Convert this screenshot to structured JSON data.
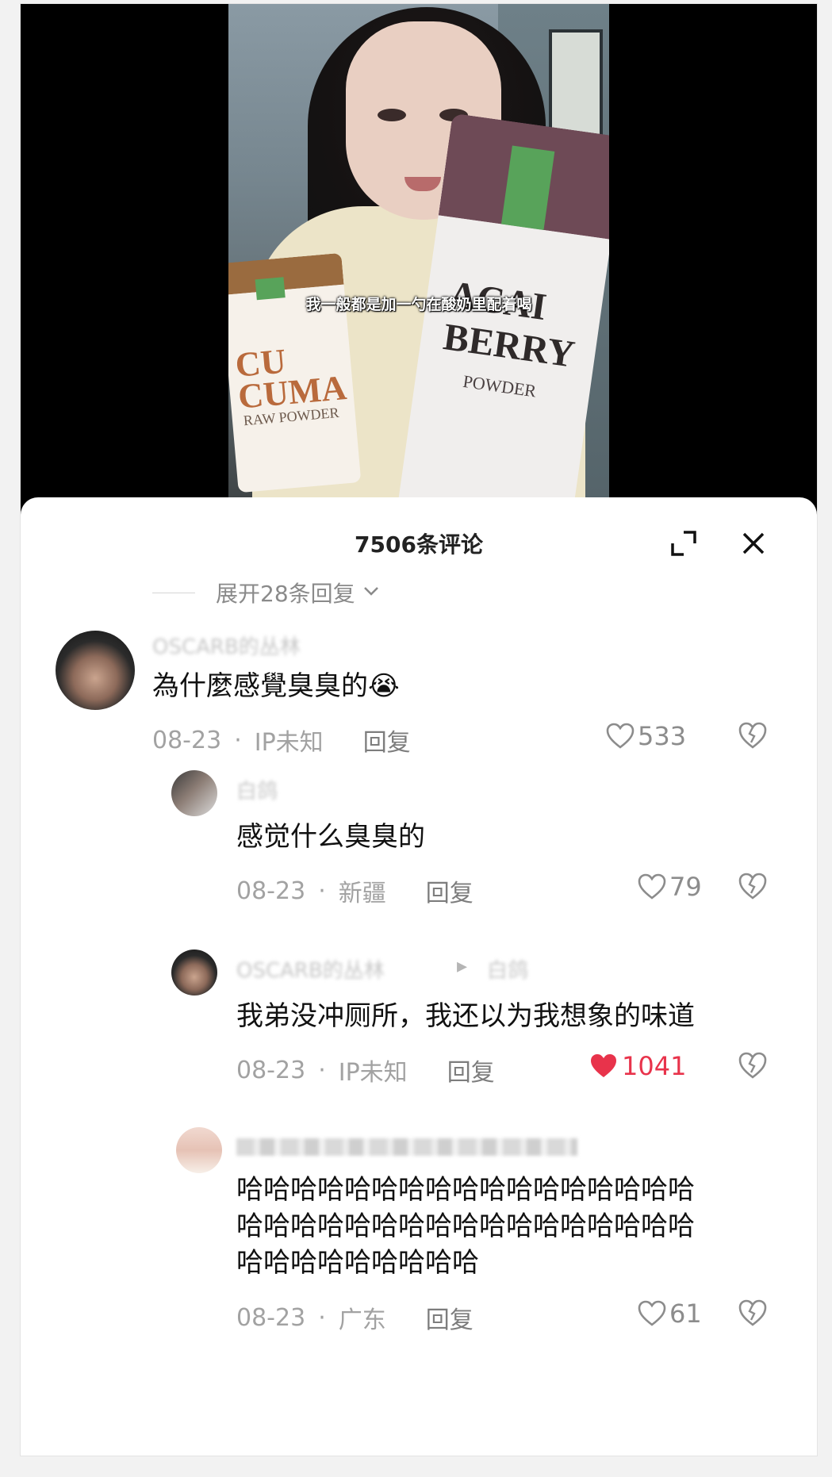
{
  "video": {
    "caption": "我一般都是加一勺在酸奶里配着喝",
    "bag_left_text": "CU CUMA",
    "bag_left_sub": "RAW POWDER",
    "bag_right_text": "ACAI BERRY",
    "bag_right_sub": "POWDER"
  },
  "sheet": {
    "title": "7506条评论",
    "expand_replies": "展开28条回复",
    "expand_icon": "expand-icon",
    "close_icon": "close-icon"
  },
  "comments": [
    {
      "username": "OSCARB的丛林",
      "text": "為什麼感覺臭臭的😭",
      "date": "08-23",
      "location": "IP未知",
      "reply_label": "回复",
      "likes": "533",
      "liked": false
    },
    {
      "username": "白鸽",
      "text": "感觉什么臭臭的",
      "date": "08-23",
      "location": "新疆",
      "reply_label": "回复",
      "likes": "79",
      "liked": false
    },
    {
      "username": "OSCARB的丛林",
      "reply_to_arrow": "▸",
      "reply_to": "白鸽",
      "text": "我弟没冲厕所，我还以为我想象的味道",
      "date": "08-23",
      "location": "IP未知",
      "reply_label": "回复",
      "likes": "1041",
      "liked": true
    },
    {
      "text": "哈哈哈哈哈哈哈哈哈哈哈哈哈哈哈哈哈哈哈哈哈哈哈哈哈哈哈哈哈哈哈哈哈哈哈哈哈哈哈哈哈哈哈",
      "date": "08-23",
      "location": "广东",
      "reply_label": "回复",
      "likes": "61",
      "liked": false
    }
  ],
  "colors": {
    "like_active": "#e8334b",
    "meta": "#a2a2a2",
    "text": "#111111"
  }
}
